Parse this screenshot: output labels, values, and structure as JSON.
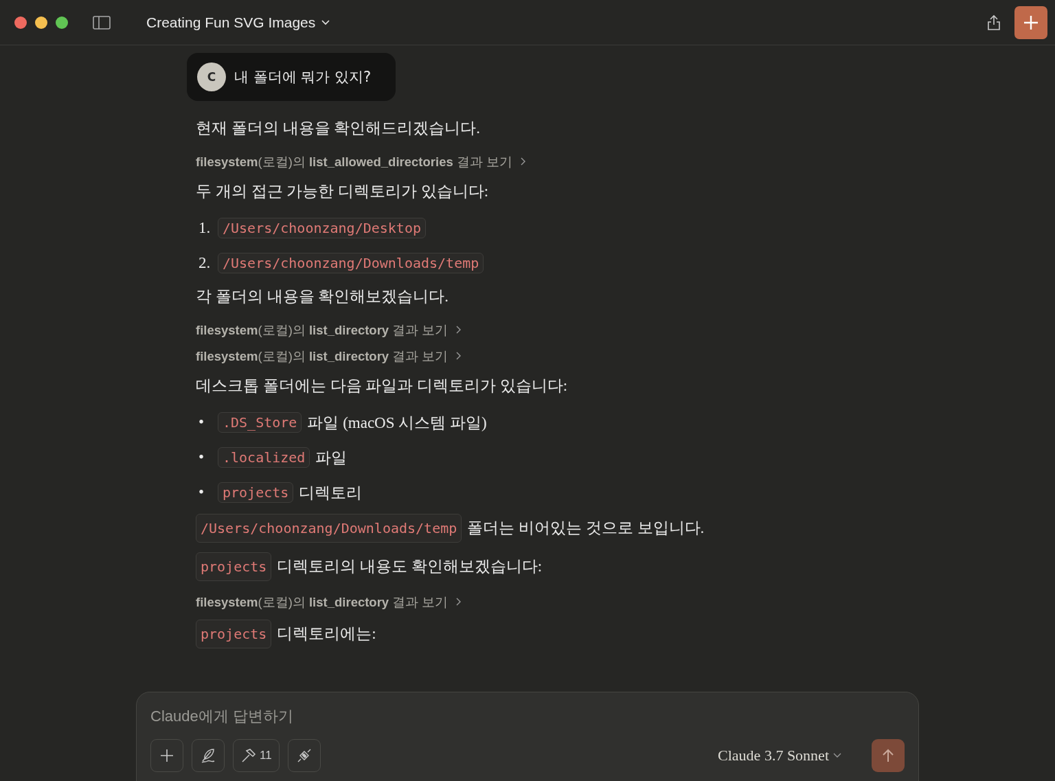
{
  "window": {
    "title": "Creating Fun SVG Images"
  },
  "user_message": {
    "avatar": "C",
    "text": "내 폴더에 뭐가 있지?"
  },
  "response": [
    {
      "kind": "paragraph",
      "segments": [
        {
          "kind": "text",
          "text": "현재 폴더의 내용을 확인해드리겠습니다."
        }
      ]
    },
    {
      "kind": "tool",
      "text": "**filesystem**(로컬)의 **list_allowed_directories** 결과 보기"
    },
    {
      "kind": "paragraph",
      "segments": [
        {
          "kind": "text",
          "text": "두 개의 접근 가능한 디렉토리가 있습니다:"
        }
      ]
    },
    {
      "kind": "list",
      "items": [
        {
          "marker": "1.",
          "segments": [
            {
              "kind": "code",
              "text": "/Users/choonzang/Desktop"
            }
          ]
        },
        {
          "marker": "2.",
          "segments": [
            {
              "kind": "code",
              "text": "/Users/choonzang/Downloads/temp"
            }
          ]
        }
      ]
    },
    {
      "kind": "paragraph",
      "segments": [
        {
          "kind": "text",
          "text": "각 폴더의 내용을 확인해보겠습니다."
        }
      ]
    },
    {
      "kind": "tool",
      "text": "**filesystem**(로컬)의 **list_directory** 결과 보기"
    },
    {
      "kind": "tool",
      "text": "**filesystem**(로컬)의 **list_directory** 결과 보기"
    },
    {
      "kind": "paragraph",
      "segments": [
        {
          "kind": "text",
          "text": "데스크톱 폴더에는 다음 파일과 디렉토리가 있습니다:"
        }
      ]
    },
    {
      "kind": "list",
      "items": [
        {
          "marker": "•",
          "segments": [
            {
              "kind": "code",
              "text": ".DS_Store"
            },
            {
              "kind": "text",
              "text": "파일 (macOS 시스템 파일)"
            }
          ]
        },
        {
          "marker": "•",
          "segments": [
            {
              "kind": "code",
              "text": ".localized"
            },
            {
              "kind": "text",
              "text": "파일"
            }
          ]
        },
        {
          "marker": "•",
          "segments": [
            {
              "kind": "code",
              "text": "projects"
            },
            {
              "kind": "text",
              "text": "디렉토리"
            }
          ]
        }
      ]
    },
    {
      "kind": "paragraph",
      "segments": [
        {
          "kind": "code",
          "text": "/Users/choonzang/Downloads/temp"
        },
        {
          "kind": "text",
          "text": "폴더는 비어있는 것으로 보입니다."
        }
      ]
    },
    {
      "kind": "paragraph",
      "segments": [
        {
          "kind": "code",
          "text": "projects"
        },
        {
          "kind": "text",
          "text": "디렉토리의 내용도 확인해보겠습니다:"
        }
      ]
    },
    {
      "kind": "tool",
      "text": "**filesystem**(로컬)의 **list_directory** 결과 보기"
    },
    {
      "kind": "paragraph",
      "segments": [
        {
          "kind": "code",
          "text": "projects"
        },
        {
          "kind": "text",
          "text": "디렉토리에는:"
        }
      ]
    }
  ],
  "composer": {
    "placeholder": "Claude에게 답변하기",
    "tools_count": "11",
    "model": "Claude 3.7 Sonnet",
    "send_disabled": true
  }
}
